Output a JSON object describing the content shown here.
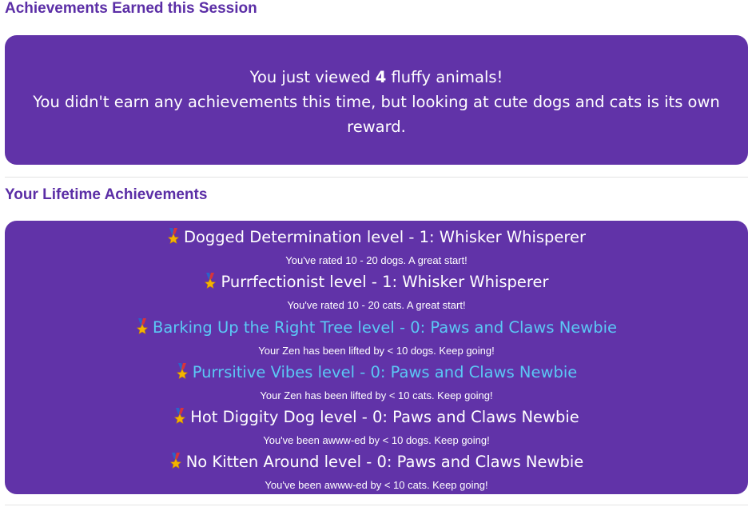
{
  "session": {
    "heading": "Achievements Earned this Session",
    "viewed_prefix": "You just viewed ",
    "viewed_count": "4",
    "viewed_suffix": " fluffy animals!",
    "message": "You didn't earn any achievements this time, but looking at cute dogs and cats is its own reward."
  },
  "lifetime": {
    "heading": "Your Lifetime Achievements",
    "achievements": [
      {
        "icon": "medal-icon",
        "title": "Dogged Determination level - 1: Whisker Whisperer",
        "description": "You've rated 10 - 20 dogs. A great start!"
      },
      {
        "icon": "medal-icon",
        "title": "Purrfectionist level - 1: Whisker Whisperer",
        "description": "You've rated 10 - 20 cats. A great start!"
      },
      {
        "icon": "medal-icon",
        "title": "Barking Up the Right Tree level - 0: Paws and Claws Newbie",
        "description": "Your Zen has been lifted by < 10 dogs. Keep going!"
      },
      {
        "icon": "medal-icon",
        "title": "Purrsitive Vibes level - 0: Paws and Claws Newbie",
        "description": "Your Zen has been lifted by < 10 cats. Keep going!"
      },
      {
        "icon": "medal-icon",
        "title": "Hot Diggity Dog level - 0: Paws and Claws Newbie",
        "description": "You've been awww-ed by < 10 dogs. Keep going!"
      },
      {
        "icon": "medal-icon",
        "title": "No Kitten Around level - 0: Paws and Claws Newbie",
        "description": "You've been awww-ed by < 10 cats. Keep going!"
      }
    ]
  },
  "colors": {
    "heading": "#5b2ea6",
    "panel_background": "#6133a8",
    "panel_text": "#ffffff",
    "highlight_title": "#5bc8f5",
    "divider": "#e4e4e4"
  }
}
